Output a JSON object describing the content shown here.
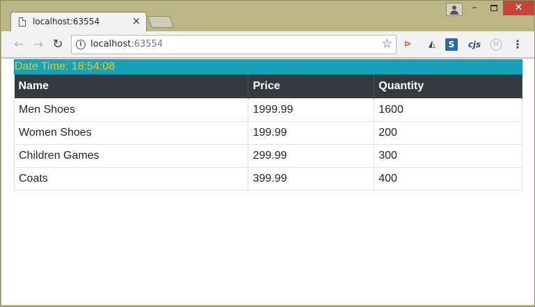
{
  "browser": {
    "tab_title": "localhost:63554",
    "tab_close": "×",
    "url_host": "localhost",
    "url_port": ":63554",
    "nav": {
      "back": "←",
      "forward": "→",
      "reload": "↻"
    },
    "star": "☆",
    "extensions": [
      {
        "name": "cast-ext",
        "glyph": "⊳"
      },
      {
        "name": "leaf-ext",
        "glyph": "◭"
      },
      {
        "name": "s-ext",
        "glyph": "S"
      },
      {
        "name": "cjs-ext",
        "glyph": "cjs"
      },
      {
        "name": "m-ext",
        "glyph": "M"
      }
    ],
    "menu": "⋮",
    "window_controls": {
      "minimize": "–",
      "close": "✕"
    }
  },
  "page": {
    "datetime_text": "Date Time: 18:54:08",
    "colors": {
      "banner_bg": "#17a2b8",
      "banner_text": "#ffc107",
      "header_bg": "#343a40"
    },
    "table": {
      "headers": [
        "Name",
        "Price",
        "Quantity"
      ],
      "rows": [
        [
          "Men Shoes",
          "1999.99",
          "1600"
        ],
        [
          "Women Shoes",
          "199.99",
          "200"
        ],
        [
          "Children Games",
          "299.99",
          "300"
        ],
        [
          "Coats",
          "399.99",
          "400"
        ]
      ]
    }
  }
}
